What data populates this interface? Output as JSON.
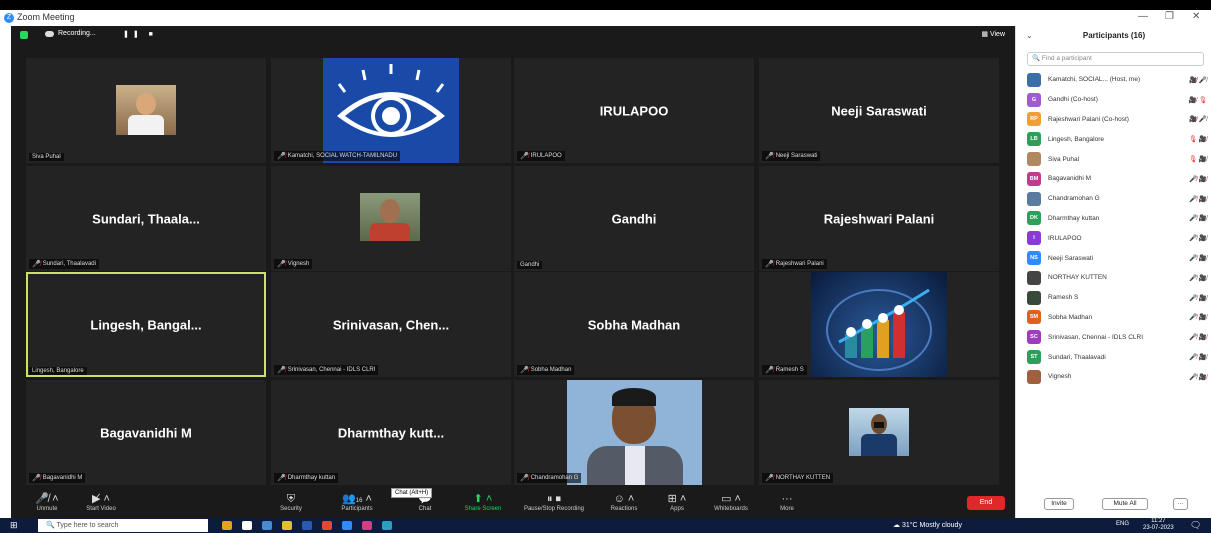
{
  "window": {
    "title": "Zoom Meeting",
    "minimize": "—",
    "restore": "❐",
    "close": "✕"
  },
  "top": {
    "recording": "Recording...",
    "rec_controls": "❚❚ ■",
    "view": "View"
  },
  "tiles": [
    {
      "label": "Siva Puhal",
      "big": "",
      "muted": false
    },
    {
      "label": "Kamatchi, SOCIAL WATCH-TAMILNADU",
      "big": "",
      "muted": true
    },
    {
      "label": "IRULAPOO",
      "big": "IRULAPOO",
      "muted": true
    },
    {
      "label": "Neeji Saraswati",
      "big": "Neeji Saraswati",
      "muted": true
    },
    {
      "label": "Sundari, Thaalavadi",
      "big": "Sundari, Thaala...",
      "muted": true
    },
    {
      "label": "Vignesh",
      "big": "",
      "muted": true
    },
    {
      "label": "Gandhi",
      "big": "Gandhi",
      "muted": false
    },
    {
      "label": "Rajeshwari Palani",
      "big": "Rajeshwari Palani",
      "muted": true
    },
    {
      "label": "Lingesh, Bangalore",
      "big": "Lingesh, Bangal...",
      "muted": false
    },
    {
      "label": "Srinivasan, Chennai - IDLS CLRI",
      "big": "Srinivasan, Chen...",
      "muted": true
    },
    {
      "label": "Sobha Madhan",
      "big": "Sobha Madhan",
      "muted": true
    },
    {
      "label": "Ramesh S",
      "big": "",
      "muted": true
    },
    {
      "label": "Bagavanidhi M",
      "big": "Bagavanidhi M",
      "muted": true
    },
    {
      "label": "Dharmthay kuttan",
      "big": "Dharmthay kutt...",
      "muted": true
    },
    {
      "label": "Chandramohan G",
      "big": "",
      "muted": true
    },
    {
      "label": "NORTHAY KUTTEN",
      "big": "",
      "muted": true
    }
  ],
  "toolbar": {
    "unmute": "Unmute",
    "start_video": "Start Video",
    "security": "Security",
    "participants": "Participants",
    "participants_count": "16",
    "chat": "Chat",
    "share_screen": "Share Screen",
    "pause_recording": "Pause/Stop Recording",
    "reactions": "Reactions",
    "apps": "Apps",
    "whiteboards": "Whiteboards",
    "more": "More",
    "end": "End",
    "chat_tooltip": "Chat (Alt+H)"
  },
  "panel": {
    "title": "Participants (16)",
    "search_placeholder": "Find a participant",
    "participants": [
      {
        "initials": "",
        "name": "Kamatchi, SOCIAL... (Host, me)",
        "color": "#3a6ea5",
        "icons": "🎥̸ 🎤̸"
      },
      {
        "initials": "G",
        "name": "Gandhi (Co-host)",
        "color": "#a05ad6",
        "icons": "🎥̸ 🎙"
      },
      {
        "initials": "RP",
        "name": "Rajeshwari Palani (Co-host)",
        "color": "#f0a030",
        "icons": "🎥̸ 🎤̸"
      },
      {
        "initials": "LB",
        "name": "Lingesh, Bangalore",
        "color": "#2e9e5b",
        "icons": "🎙 🎥̸"
      },
      {
        "initials": "",
        "name": "Siva Puhal",
        "color": "#b08860",
        "icons": "🎙 🎥̸"
      },
      {
        "initials": "BM",
        "name": "Bagavanidhi M",
        "color": "#c03b8b",
        "icons": "🎤̸ 🎥̸"
      },
      {
        "initials": "",
        "name": "Chandramohan G",
        "color": "#5a7aa0",
        "icons": "🎤̸ 🎥̸"
      },
      {
        "initials": "DK",
        "name": "Dharmthay kuttan",
        "color": "#2e9e5b",
        "icons": "🎤̸ 🎥̸"
      },
      {
        "initials": "I",
        "name": "IRULAPOO",
        "color": "#8a3ad6",
        "icons": "🎤̸ 🎥̸"
      },
      {
        "initials": "NS",
        "name": "Neeji Saraswati",
        "color": "#2d8cff",
        "icons": "🎤̸ 🎥̸"
      },
      {
        "initials": "",
        "name": "NORTHAY KUTTEN",
        "color": "#444",
        "icons": "🎤̸ 🎥̸"
      },
      {
        "initials": "",
        "name": "Ramesh S",
        "color": "#3a4a3a",
        "icons": "🎤̸ 🎥̸"
      },
      {
        "initials": "SM",
        "name": "Sobha Madhan",
        "color": "#e06020",
        "icons": "🎤̸ 🎥̸"
      },
      {
        "initials": "SC",
        "name": "Srinivasan, Chennai - IDLS CLRI",
        "color": "#a03ac0",
        "icons": "🎤̸ 🎥̸"
      },
      {
        "initials": "ST",
        "name": "Sundari, Thaalavadi",
        "color": "#2e9e5b",
        "icons": "🎤̸ 🎥̸"
      },
      {
        "initials": "",
        "name": "Vignesh",
        "color": "#a06040",
        "icons": "🎤̸ 🎥̸"
      }
    ],
    "invite": "Invite",
    "mute_all": "Mute All",
    "more": "···"
  },
  "taskbar": {
    "search": "Type here to search",
    "weather": "31°C  Mostly cloudy",
    "lang": "ENG",
    "time": "11:27",
    "date": "23-07-2023"
  }
}
